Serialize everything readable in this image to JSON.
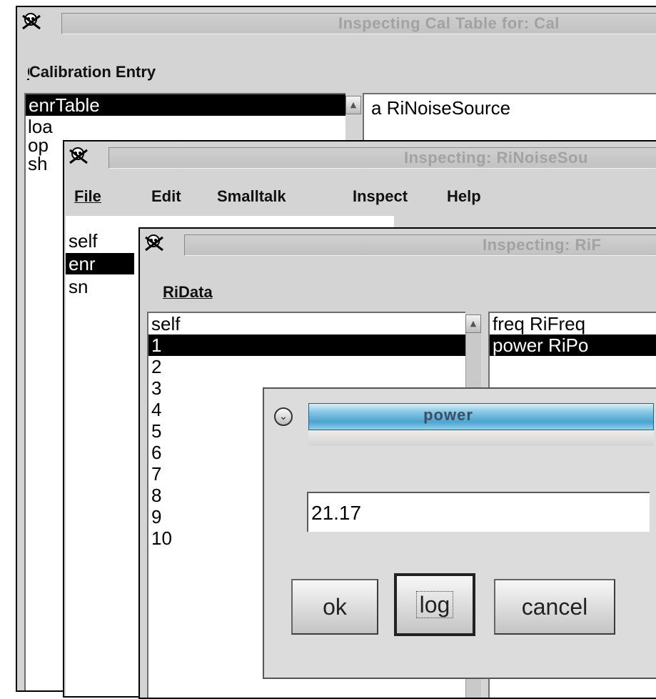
{
  "calWindow": {
    "title": "Inspecting Cal Table for: Cal",
    "menu": [
      "Calibration Entry"
    ],
    "fields": [
      {
        "label": "enrTable",
        "selected": true
      },
      {
        "label": "loa"
      },
      {
        "label": "op"
      },
      {
        "label": "sh"
      }
    ],
    "value": "a RiNoiseSource"
  },
  "noiseWindow": {
    "title": "Inspecting: RiNoiseSou",
    "menu": [
      "File",
      "Edit",
      "Smalltalk",
      "Inspect",
      "Help"
    ],
    "fields": [
      {
        "label": "self"
      },
      {
        "label": "enr",
        "selected": true
      },
      {
        "label": "sn"
      }
    ]
  },
  "dataWindow": {
    "title": "Inspecting: RiF",
    "menu": [
      "RiData"
    ],
    "fields": [
      {
        "label": "self"
      },
      {
        "label": "1",
        "selected": true
      },
      {
        "label": "2"
      },
      {
        "label": "3"
      },
      {
        "label": "4"
      },
      {
        "label": "5"
      },
      {
        "label": "6"
      },
      {
        "label": "7"
      },
      {
        "label": "8"
      },
      {
        "label": "9"
      },
      {
        "label": "10"
      }
    ],
    "values": [
      {
        "label": "freq RiFreq"
      },
      {
        "label": "power RiPo",
        "selected": true
      }
    ]
  },
  "powerDialog": {
    "title": "power",
    "input_value": "21.17",
    "buttons": {
      "ok": "ok",
      "log": "log",
      "cancel": "cancel"
    },
    "colors": {
      "title_bar": "#6fb3d8"
    }
  }
}
